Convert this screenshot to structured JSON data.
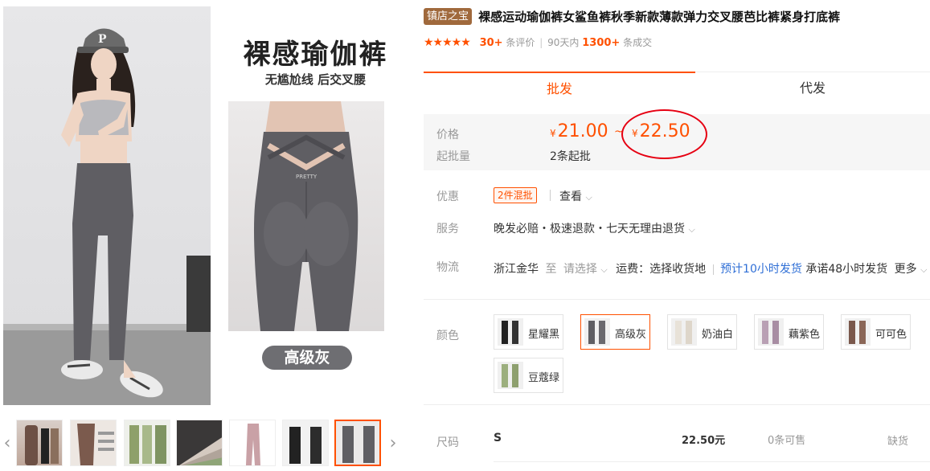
{
  "promo": {
    "title": "裸感瑜伽裤",
    "subtitle": "无尴尬线 后交叉腰",
    "color_badge": "高级灰",
    "waist_logo": "PRETTY"
  },
  "gallery": {
    "prev_arrow": "‹",
    "next_arrow": "›",
    "thumb_count": 7,
    "active_thumb_index": 6
  },
  "product": {
    "shop_badge": "镇店之宝",
    "title": "裸感运动瑜伽裤女鲨鱼裤秋季新款薄款弹力交叉腰芭比裤紧身打底裤",
    "stars": "★★★★★",
    "reviews_count": "30+",
    "reviews_label": "条评价",
    "sales_prefix": "90天内",
    "sales_count": "1300+",
    "sales_label": "条成交"
  },
  "tabs": [
    {
      "label": "批发",
      "active": true
    },
    {
      "label": "代发",
      "active": false
    }
  ],
  "price": {
    "label": "价格",
    "currency": "¥",
    "low": "21.00",
    "separator": "~",
    "high": "22.50",
    "min_label": "起批量",
    "min_value": "2条起批"
  },
  "promotion": {
    "label": "优惠",
    "tag": "2件混批",
    "view": "查看"
  },
  "service": {
    "label": "服务",
    "value": "晚发必赔・极速退款・七天无理由退货"
  },
  "logistics": {
    "label": "物流",
    "from": "浙江金华",
    "to_word": "至",
    "select": "请选择",
    "freight": "运费：选择收货地",
    "eta": "预计10小时发货",
    "promise": "承诺48小时发货",
    "more": "更多"
  },
  "color": {
    "label": "颜色",
    "options": [
      {
        "name": "星耀黑",
        "active": false
      },
      {
        "name": "高级灰",
        "active": true
      },
      {
        "name": "奶油白",
        "active": false
      },
      {
        "name": "藕紫色",
        "active": false
      },
      {
        "name": "可可色",
        "active": false
      },
      {
        "name": "豆蔻绿",
        "active": false
      }
    ]
  },
  "size": {
    "label": "尺码",
    "rows": [
      {
        "size": "S",
        "price": "22.50元",
        "stock": "0条可售",
        "status": "缺货"
      }
    ]
  },
  "colors": {
    "accent": "#ff5000",
    "circle": "#e60012",
    "badge": "#a0693c",
    "link": "#2f6fd6",
    "legging_gray": "#5f5e63"
  }
}
